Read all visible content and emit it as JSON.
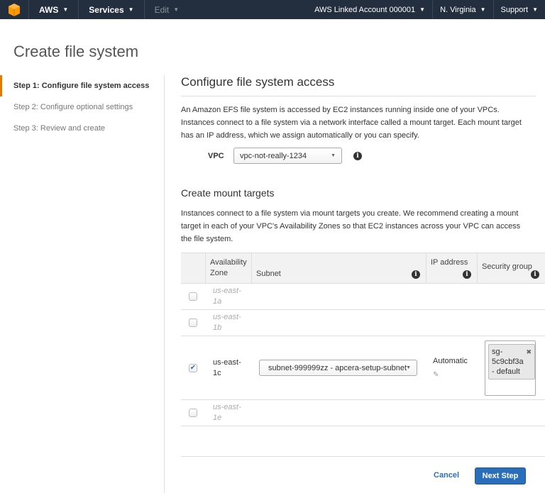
{
  "nav": {
    "aws": "AWS",
    "services": "Services",
    "edit": "Edit",
    "account": "AWS Linked Account 000001",
    "region": "N. Virginia",
    "support": "Support",
    "logo_color": "#f90"
  },
  "page_title": "Create file system",
  "steps": [
    "Step 1: Configure file system access",
    "Step 2: Configure optional settings",
    "Step 3: Review and create"
  ],
  "section1": {
    "title": "Configure file system access",
    "description": "An Amazon EFS file system is accessed by EC2 instances running inside one of your VPCs. Instances connect to a file system via a network interface called a mount target. Each mount target has an IP address, which we assign automatically or you can specify.",
    "vpc_label": "VPC",
    "vpc_value": "vpc-not-really-1234"
  },
  "section2": {
    "title": "Create mount targets",
    "description": "Instances connect to a file system via mount targets you create. We recommend creating a mount target in each of your VPC's Availability Zones so that EC2 instances across your VPC can access the file system."
  },
  "table": {
    "headers": {
      "az_line1": "Availability",
      "az_line2": "Zone",
      "subnet": "Subnet",
      "ip": "IP address",
      "sg": "Security group"
    },
    "rows": [
      {
        "az_line1": "us-east-",
        "az_line2": "1a",
        "checked": false
      },
      {
        "az_line1": "us-east-",
        "az_line2": "1b",
        "checked": false
      },
      {
        "az_line1": "us-east-",
        "az_line2": "1c",
        "checked": true,
        "subnet": "subnet-999999zz - apcera-setup-subnet",
        "ip": "Automatic",
        "sg_line1": "sg-",
        "sg_line2": "5c9cbf3a",
        "sg_line3": "- default"
      },
      {
        "az_line1": "us-east-",
        "az_line2": "1e",
        "checked": false
      }
    ]
  },
  "buttons": {
    "cancel": "Cancel",
    "next": "Next Step"
  }
}
